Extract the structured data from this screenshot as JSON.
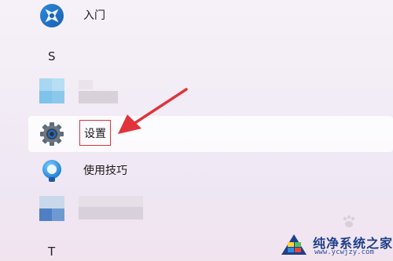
{
  "start_menu": {
    "items": [
      {
        "label": "入门",
        "icon": "get-started-icon"
      },
      {
        "section": "S"
      },
      {
        "label": "",
        "icon": "blurred-app-icon"
      },
      {
        "label": "设置",
        "icon": "gear-icon",
        "selected": true
      },
      {
        "label": "使用技巧",
        "icon": "tips-bulb-icon"
      },
      {
        "label": "",
        "icon": "blurred-app-icon"
      },
      {
        "section": "T"
      }
    ]
  },
  "annotation": {
    "highlight_color": "#e0343a"
  },
  "watermark": {
    "title": "纯净系统之家",
    "url": "www.ycwjzy.com",
    "brand_color": "#1e3f8a"
  }
}
